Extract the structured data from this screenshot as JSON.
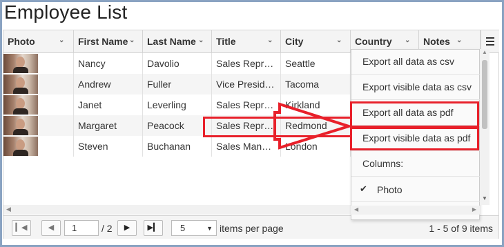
{
  "page": {
    "title": "Employee List"
  },
  "grid": {
    "columns": [
      {
        "label": "Photo"
      },
      {
        "label": "First Name"
      },
      {
        "label": "Last Name"
      },
      {
        "label": "Title"
      },
      {
        "label": "City"
      },
      {
        "label": "Country"
      },
      {
        "label": "Notes"
      }
    ],
    "rows": [
      {
        "first": "Nancy",
        "last": "Davolio",
        "title": "Sales Repr…",
        "city": "Seattle"
      },
      {
        "first": "Andrew",
        "last": "Fuller",
        "title": "Vice Presid…",
        "city": "Tacoma"
      },
      {
        "first": "Janet",
        "last": "Leverling",
        "title": "Sales Repr…",
        "city": "Kirkland"
      },
      {
        "first": "Margaret",
        "last": "Peacock",
        "title": "Sales Repr…",
        "city": "Redmond"
      },
      {
        "first": "Steven",
        "last": "Buchanan",
        "title": "Sales Man…",
        "city": "London"
      }
    ]
  },
  "column_menu": {
    "items": [
      {
        "label": "Export all data as csv"
      },
      {
        "label": "Export visible data as csv"
      },
      {
        "label": "Export all data as pdf"
      },
      {
        "label": "Export visible data as pdf"
      }
    ],
    "columns_heading": "Columns:",
    "column_toggle": {
      "label": "Photo",
      "checked": true
    }
  },
  "pager": {
    "current_page": "1",
    "total_pages": "/ 2",
    "page_size": "5",
    "per_page_label": "items per page",
    "summary": "1 - 5 of 9 items"
  },
  "colors": {
    "annotation": "#e8202a",
    "frame": "#8aa3c2"
  },
  "icons": {
    "first_page": "first-page-icon",
    "prev_page": "prev-page-icon",
    "next_page": "next-page-icon",
    "last_page": "last-page-icon",
    "menu": "hamburger-menu-icon",
    "sort_chevron": "chevron-down-icon",
    "checkmark": "checkmark-icon"
  }
}
